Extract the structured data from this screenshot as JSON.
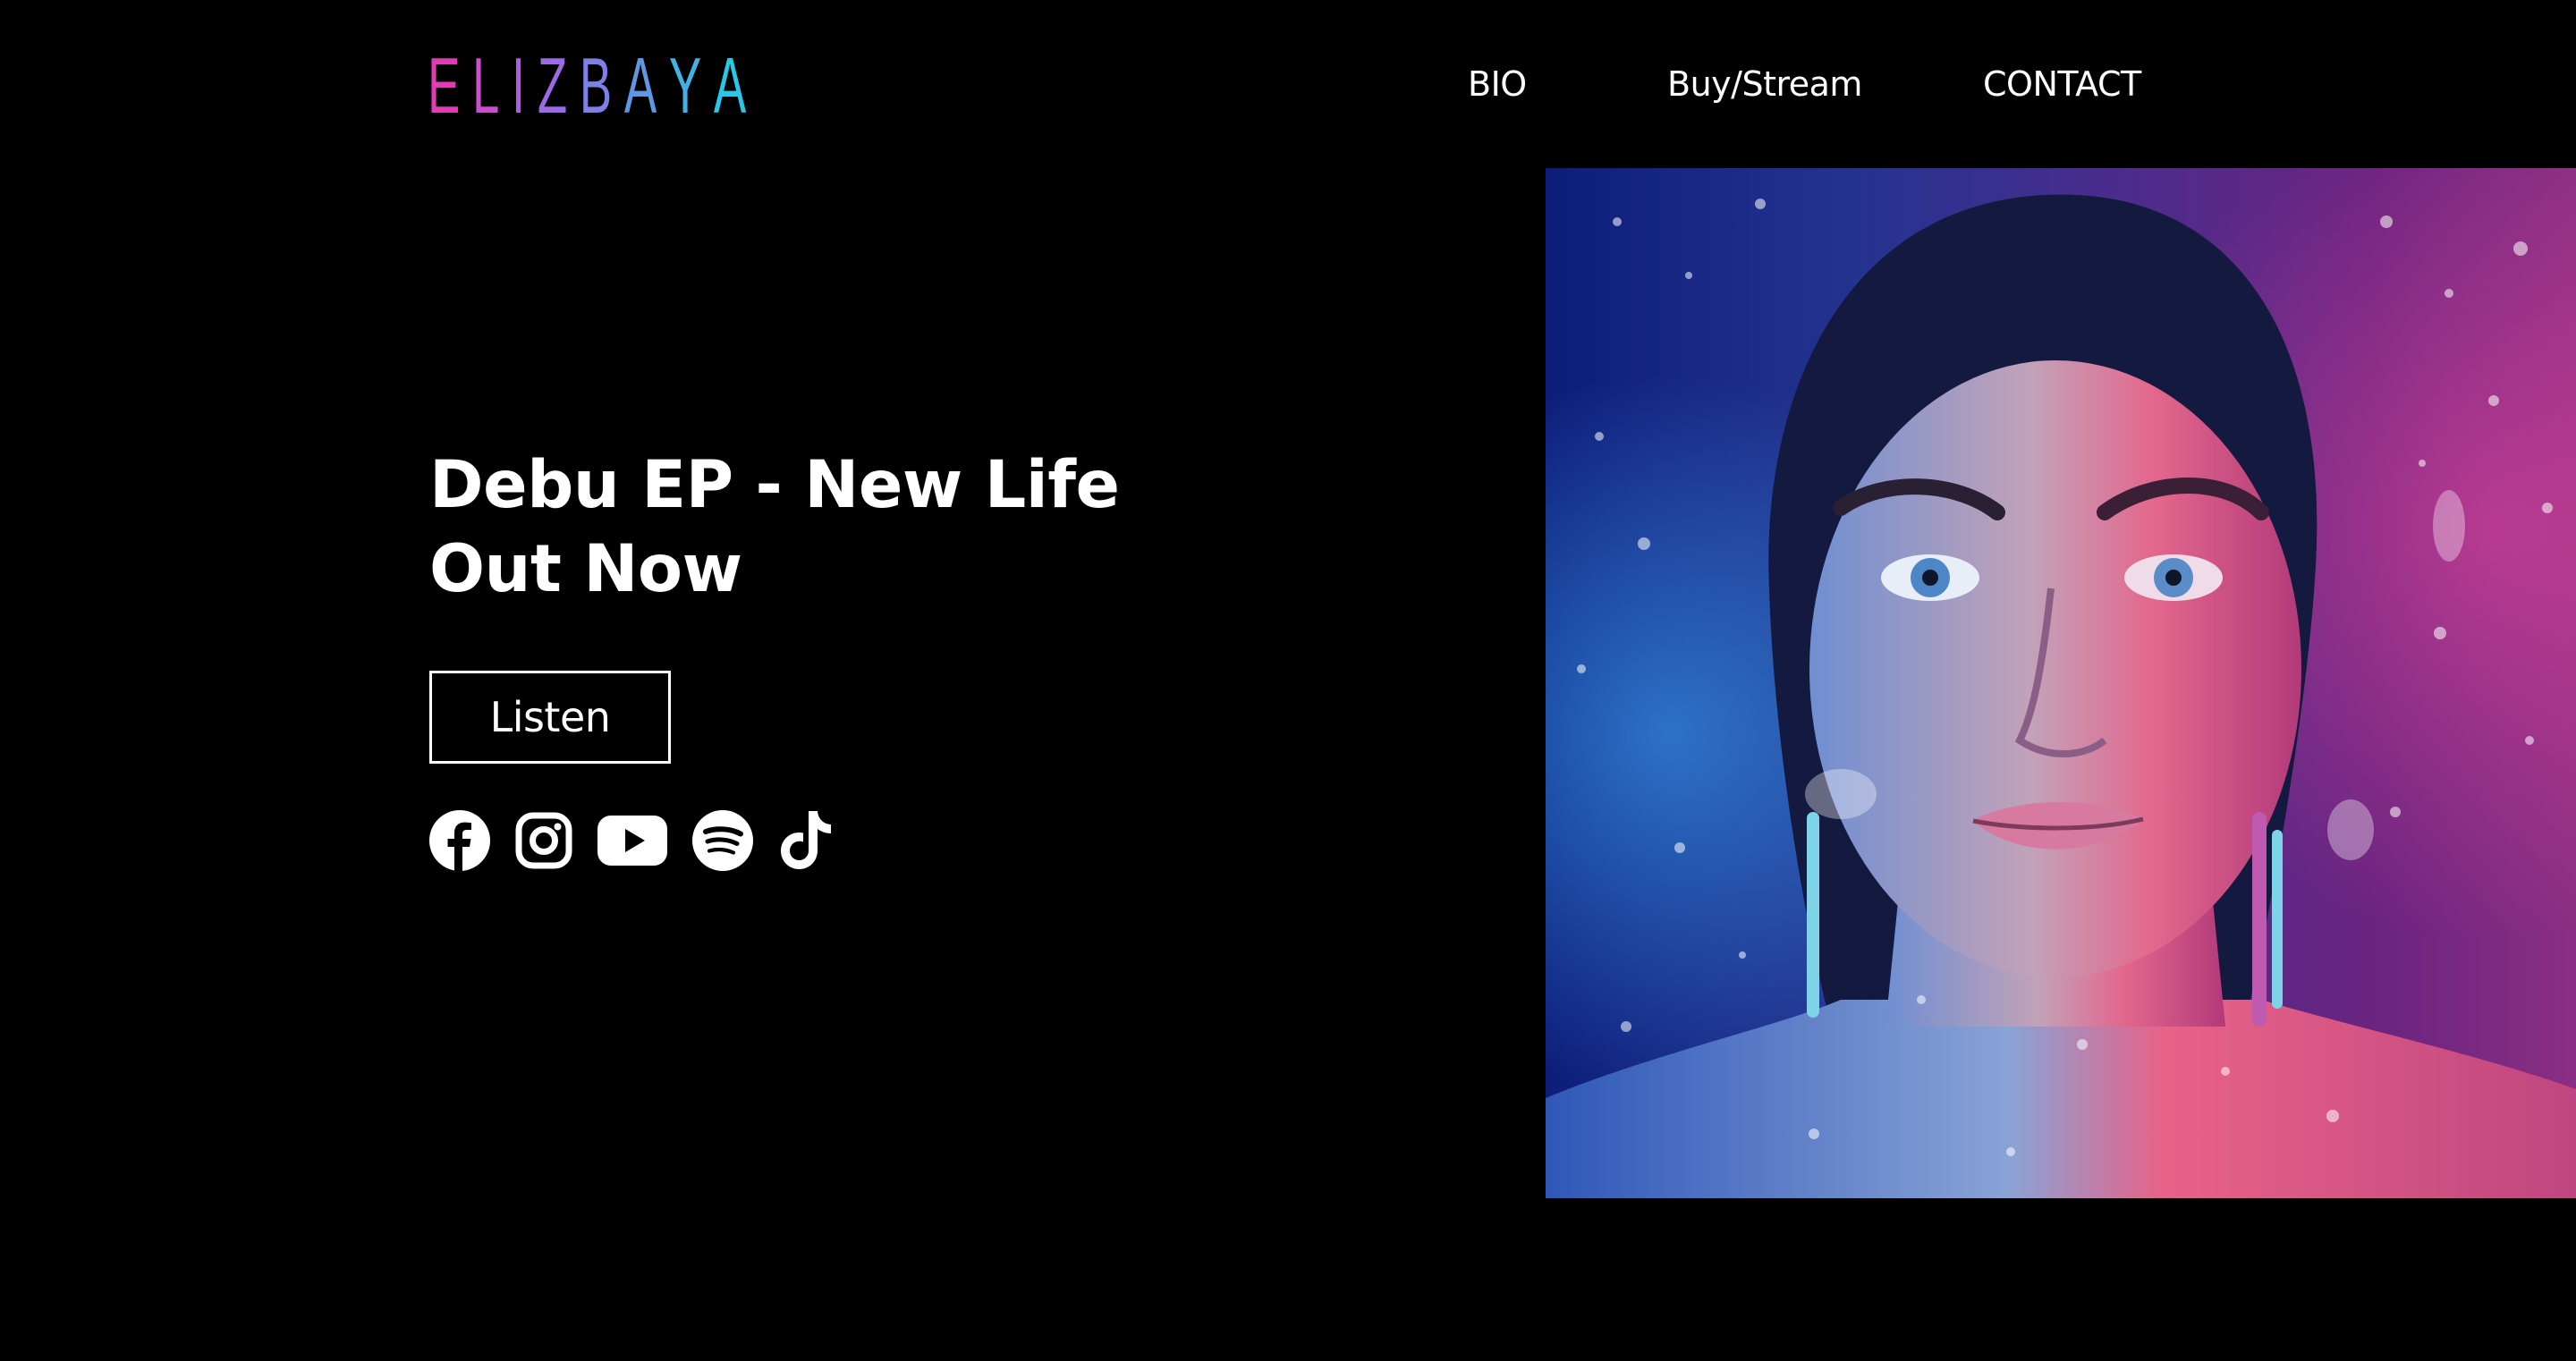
{
  "brand": {
    "logo_letters": [
      "E",
      "L",
      "I",
      "Z",
      "B",
      "A",
      "Y",
      "A"
    ],
    "logo_colors": [
      "#e23bb6",
      "#cc4dd0",
      "#b45ae0",
      "#9b6be6",
      "#7d80e4",
      "#5f98e2",
      "#40b2e4",
      "#27c9e6"
    ]
  },
  "nav": {
    "bio_label": "BIO",
    "buy_label": "Buy/Stream",
    "contact_label": "CONTACT"
  },
  "hero": {
    "headline_line1": "Debu EP - New Life",
    "headline_line2": "Out Now",
    "listen_label": "Listen",
    "social_icons": [
      "facebook-icon",
      "instagram-icon",
      "youtube-icon",
      "spotify-icon",
      "tiktok-icon"
    ]
  },
  "colors": {
    "background": "#000000",
    "text": "#ffffff",
    "gradient_start": "#e23bb6",
    "gradient_end": "#27c9e6"
  }
}
